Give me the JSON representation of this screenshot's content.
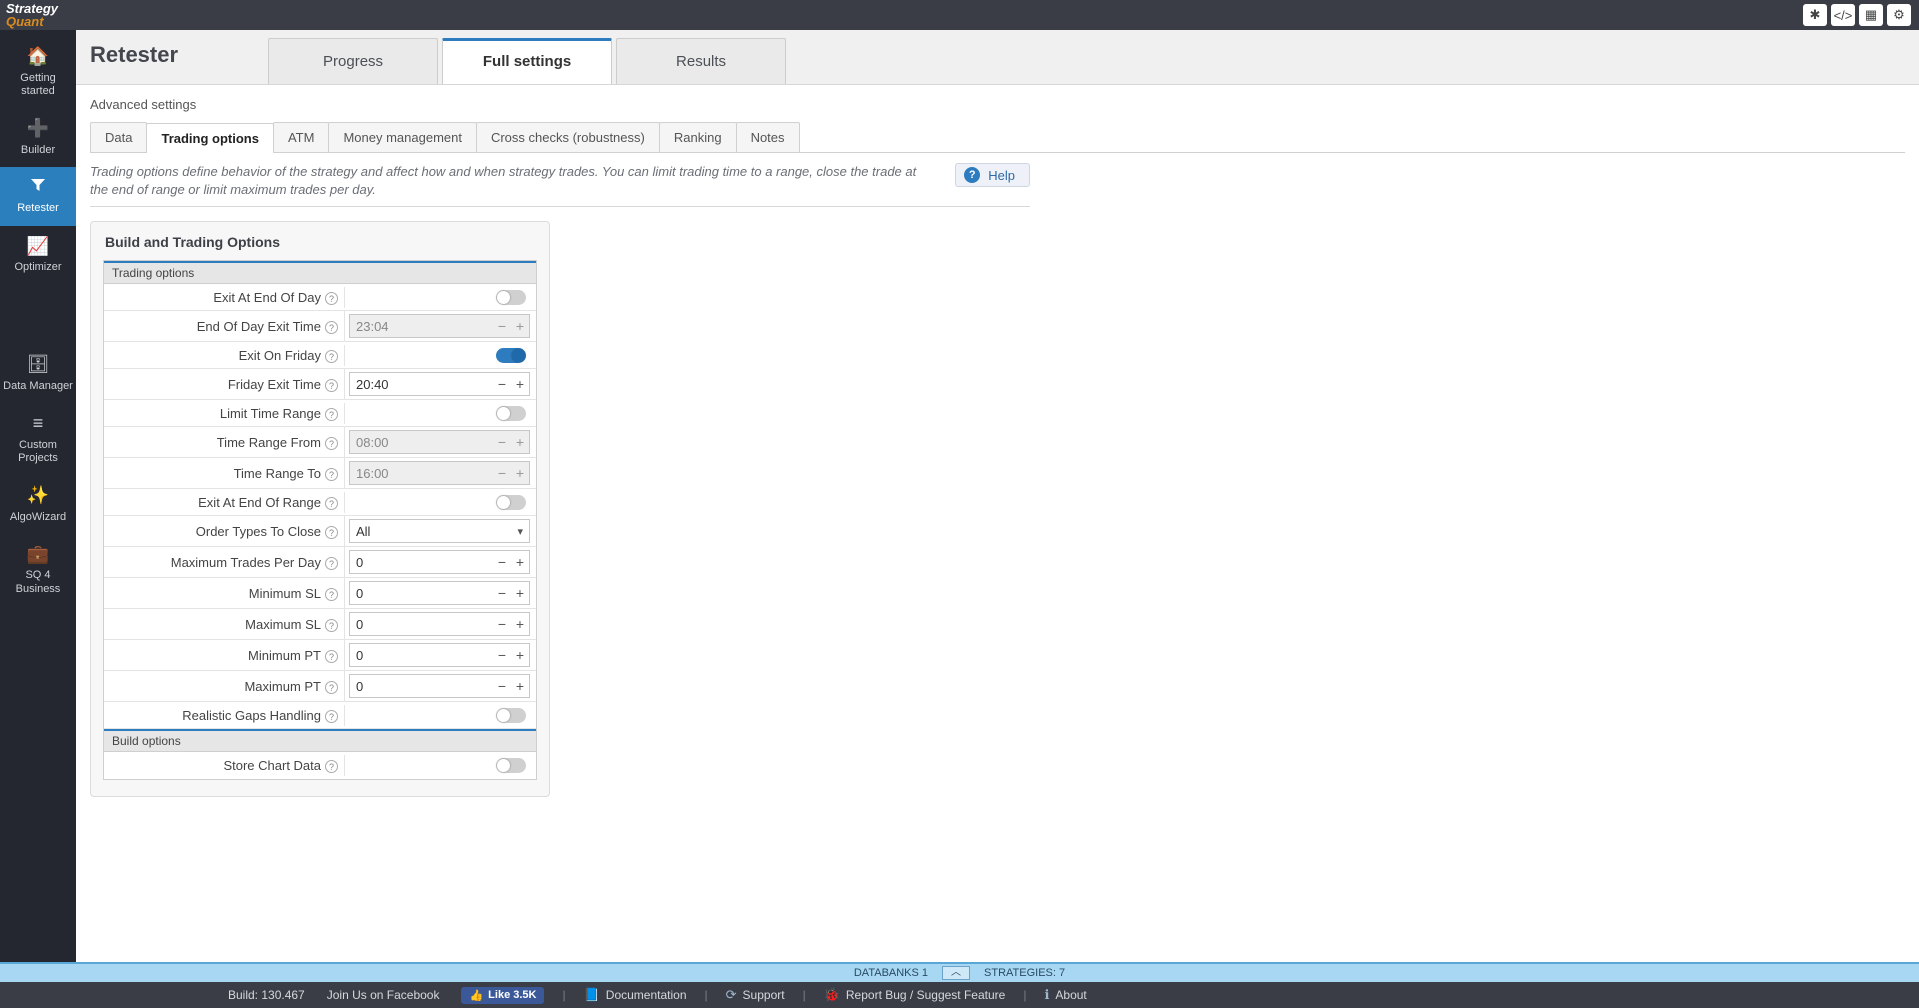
{
  "logo": {
    "line1": "Strategy",
    "line2": "Quant"
  },
  "sidebar": {
    "items": [
      {
        "label": "Getting\nstarted",
        "icon": "🏠"
      },
      {
        "label": "Builder",
        "icon": "➕"
      },
      {
        "label": "Retester",
        "icon": "▾",
        "funnel": true
      },
      {
        "label": "Optimizer",
        "icon": "📈"
      },
      {
        "label": "Data Manager",
        "icon": "🗄"
      },
      {
        "label": "Custom\nProjects",
        "icon": "≡"
      },
      {
        "label": "AlgoWizard",
        "icon": "✨"
      },
      {
        "label": "SQ 4 Business",
        "icon": "💼"
      }
    ],
    "activeIndex": 2
  },
  "page": {
    "title": "Retester",
    "breadcrumb": "Advanced settings"
  },
  "mainTabs": {
    "items": [
      "Progress",
      "Full settings",
      "Results"
    ],
    "activeIndex": 1
  },
  "subTabs": {
    "items": [
      "Data",
      "Trading options",
      "ATM",
      "Money management",
      "Cross checks (robustness)",
      "Ranking",
      "Notes"
    ],
    "activeIndex": 1
  },
  "description": "Trading options define behavior of the strategy and affect how and when strategy trades. You can limit trading time to a range, close the trade at the end of range or limit maximum trades per day.",
  "helpLabel": "Help",
  "panel": {
    "title": "Build and Trading Options",
    "section1": "Trading options",
    "section2": "Build options",
    "rows": {
      "exitEod": {
        "label": "Exit At End Of Day",
        "type": "toggle",
        "value": false
      },
      "eodTime": {
        "label": "End Of Day Exit Time",
        "type": "spinner",
        "value": "23:04",
        "disabled": true
      },
      "exitFriday": {
        "label": "Exit On Friday",
        "type": "toggle",
        "value": true
      },
      "fridayTime": {
        "label": "Friday Exit Time",
        "type": "spinner",
        "value": "20:40",
        "disabled": false
      },
      "limitRange": {
        "label": "Limit Time Range",
        "type": "toggle",
        "value": false
      },
      "rangeFrom": {
        "label": "Time Range From",
        "type": "spinner",
        "value": "08:00",
        "disabled": true
      },
      "rangeTo": {
        "label": "Time Range To",
        "type": "spinner",
        "value": "16:00",
        "disabled": true
      },
      "exitEndRange": {
        "label": "Exit At End Of Range",
        "type": "toggle",
        "value": false
      },
      "orderTypes": {
        "label": "Order Types To Close",
        "type": "select",
        "value": "All"
      },
      "maxTrades": {
        "label": "Maximum Trades Per Day",
        "type": "spinner",
        "value": "0"
      },
      "minSL": {
        "label": "Minimum SL",
        "type": "spinner",
        "value": "0"
      },
      "maxSL": {
        "label": "Maximum SL",
        "type": "spinner",
        "value": "0"
      },
      "minPT": {
        "label": "Minimum PT",
        "type": "spinner",
        "value": "0"
      },
      "maxPT": {
        "label": "Maximum PT",
        "type": "spinner",
        "value": "0"
      },
      "gaps": {
        "label": "Realistic Gaps Handling",
        "type": "toggle",
        "value": false
      },
      "storeChart": {
        "label": "Store Chart Data",
        "type": "toggle",
        "value": false
      }
    }
  },
  "rowOrder1": [
    "exitEod",
    "eodTime",
    "exitFriday",
    "fridayTime",
    "limitRange",
    "rangeFrom",
    "rangeTo",
    "exitEndRange",
    "orderTypes",
    "maxTrades",
    "minSL",
    "maxSL",
    "minPT",
    "maxPT",
    "gaps"
  ],
  "rowOrder2": [
    "storeChart"
  ],
  "databar": {
    "databanks": "DATABANKS 1",
    "strategies": "STRATEGIES: 7"
  },
  "footer": {
    "build": "Build: 130.467",
    "join": "Join Us on Facebook",
    "like": "Like 3.5K",
    "links": [
      "Documentation",
      "Support",
      "Report Bug / Suggest Feature",
      "About"
    ],
    "linkIcons": [
      "📘",
      "⟳",
      "🐞",
      "ℹ"
    ]
  }
}
